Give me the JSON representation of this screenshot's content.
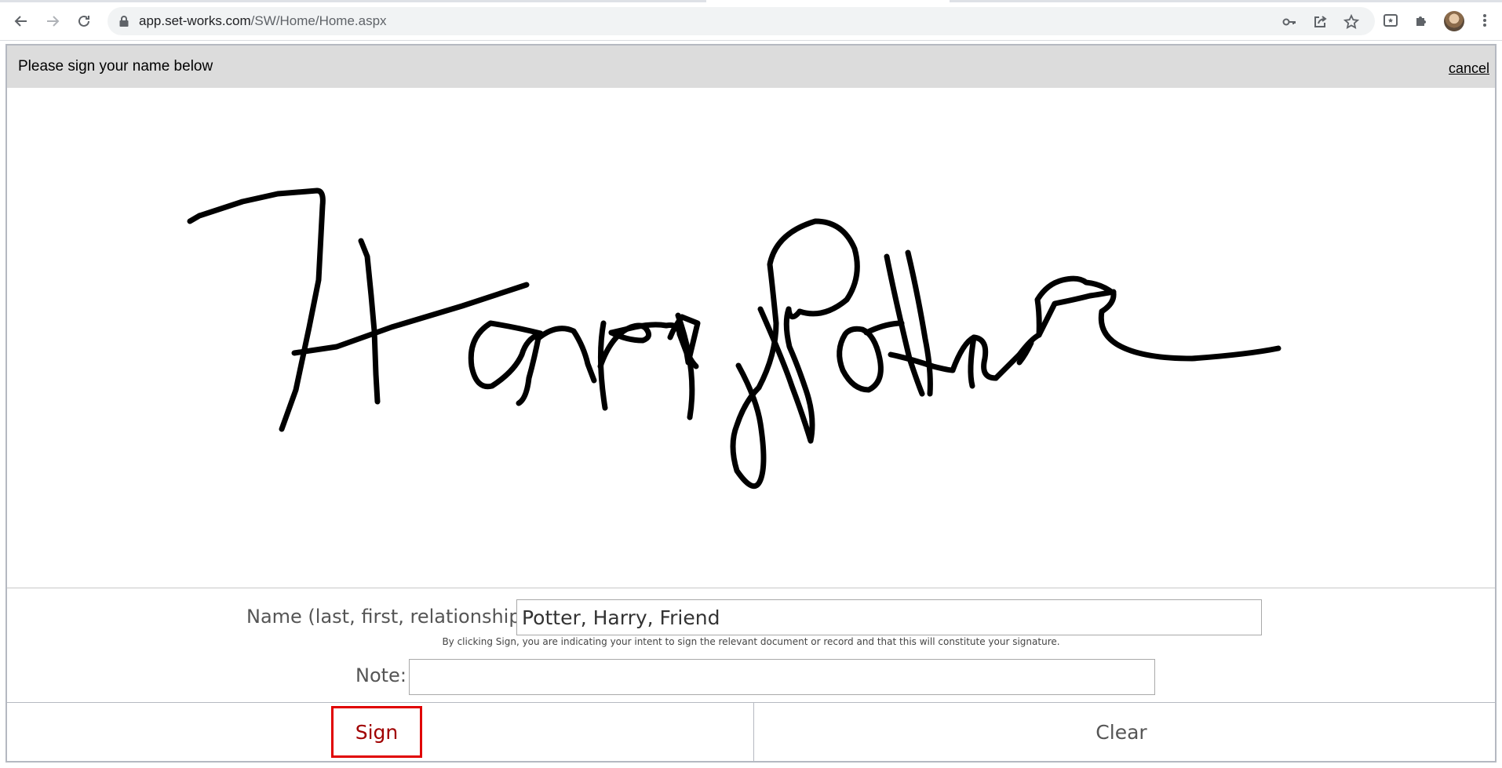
{
  "browser": {
    "url_domain": "app.set-works.com",
    "url_path": "/SW/Home/Home.aspx"
  },
  "dialog": {
    "title": "Please sign your name below",
    "cancel_label": "cancel",
    "signature_text": "Harry Potter",
    "name_label": "Name (last, first, relationship):",
    "name_value": "Potter, Harry, Friend",
    "disclaimer": "By clicking Sign, you are indicating your intent to sign the relevant document or record and that this will constitute your signature.",
    "note_label": "Note:",
    "note_value": "",
    "sign_label": "Sign",
    "clear_label": "Clear"
  },
  "icons": {
    "back": "back-arrow-icon",
    "forward": "forward-arrow-icon",
    "reload": "reload-icon",
    "lock": "lock-icon",
    "key": "key-icon",
    "share": "share-icon",
    "star": "star-icon",
    "reader": "reading-mode-icon",
    "extensions": "puzzle-icon",
    "menu": "kebab-menu-icon"
  },
  "colors": {
    "header_bg": "#dcdcdc",
    "sign_border": "#e00000",
    "sign_text": "#a00000"
  }
}
